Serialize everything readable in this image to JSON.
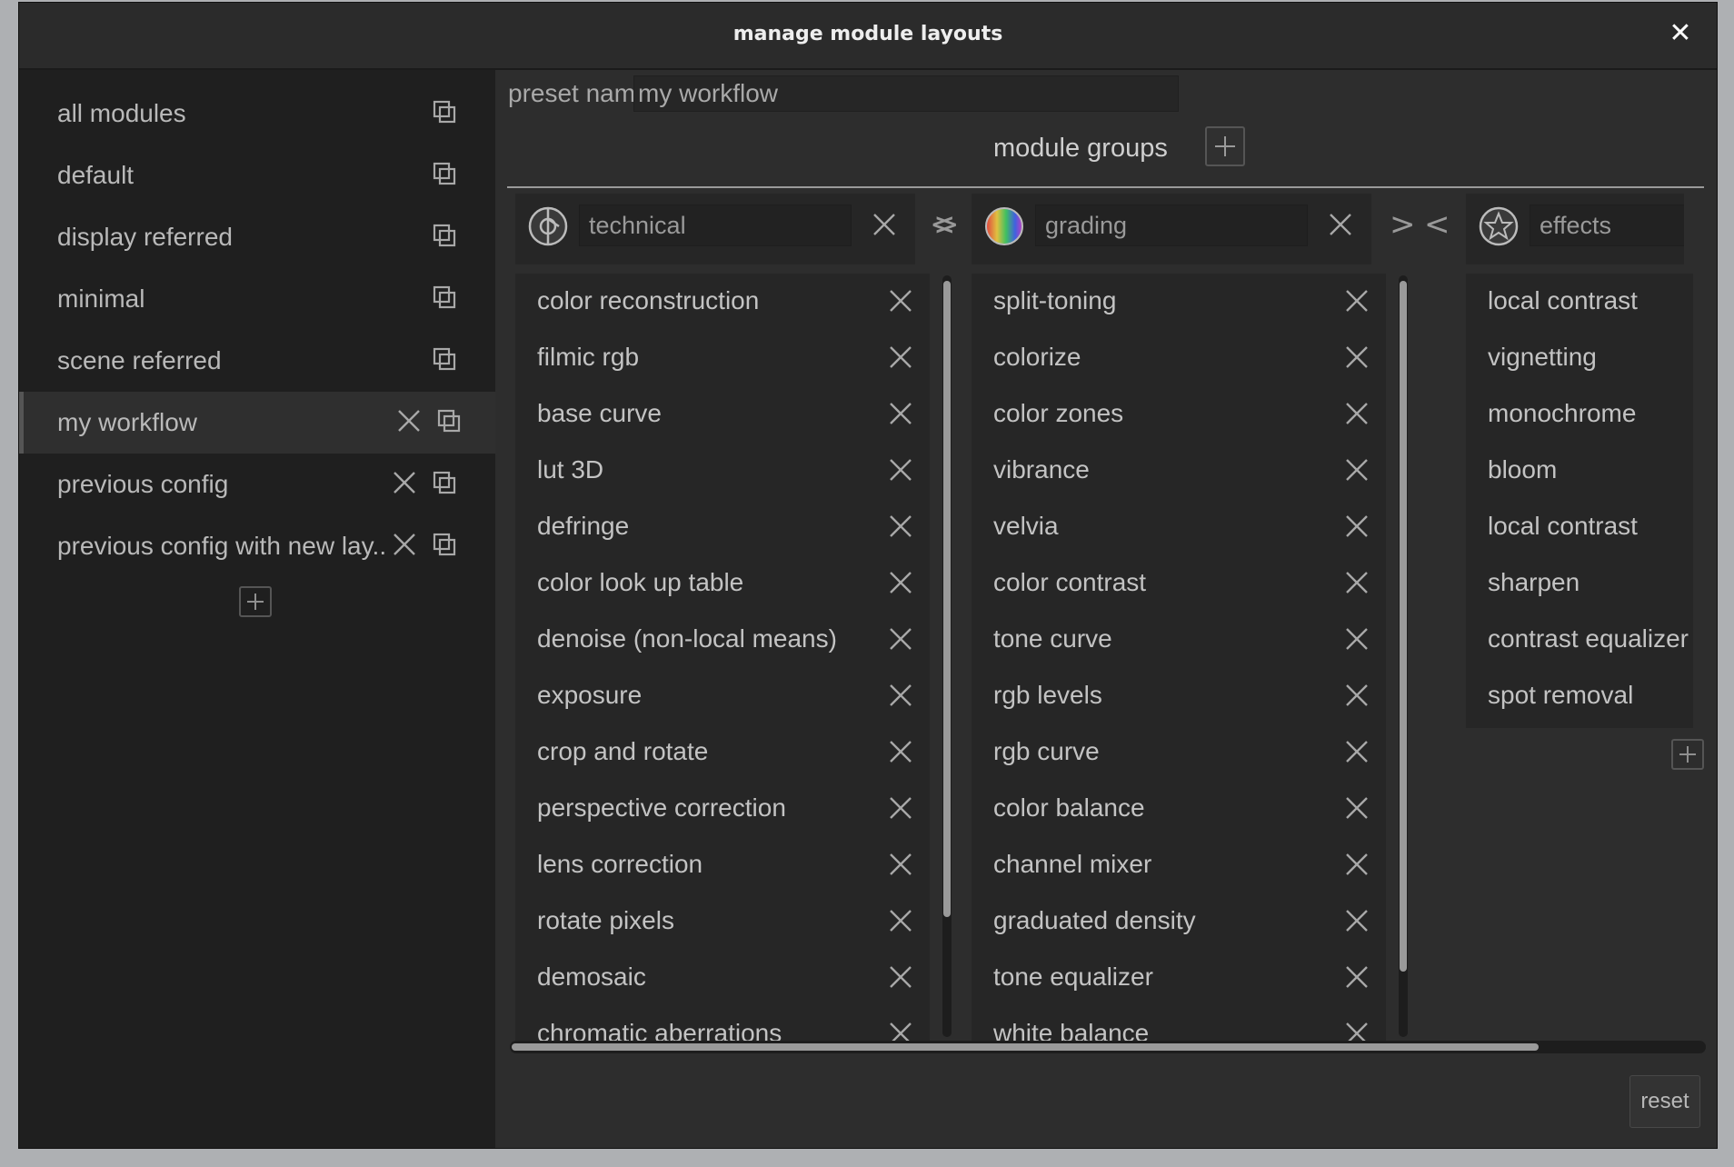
{
  "window": {
    "title": "manage module layouts",
    "close_glyph": "✕"
  },
  "sidebar": {
    "presets": [
      {
        "label": "all modules",
        "deletable": false,
        "active": false
      },
      {
        "label": "default",
        "deletable": false,
        "active": false
      },
      {
        "label": "display referred",
        "deletable": false,
        "active": false
      },
      {
        "label": "minimal",
        "deletable": false,
        "active": false
      },
      {
        "label": "scene referred",
        "deletable": false,
        "active": false
      },
      {
        "label": "my workflow",
        "deletable": true,
        "active": true
      },
      {
        "label": "previous config",
        "deletable": true,
        "active": false
      },
      {
        "label": "previous config with new lay...",
        "deletable": true,
        "active": false
      }
    ]
  },
  "editor": {
    "preset_name_label": "preset name :",
    "preset_name_value": "my workflow",
    "groups_heading": "module groups",
    "groups": [
      {
        "name": "technical",
        "icon": "technical-group-icon",
        "modules": [
          "color reconstruction",
          "filmic rgb",
          "base curve",
          "lut 3D",
          "defringe",
          "color look up table",
          "denoise (non-local means)",
          "exposure",
          "crop and rotate",
          "perspective correction",
          "lens correction",
          "rotate pixels",
          "demosaic",
          "chromatic aberrations"
        ]
      },
      {
        "name": "grading",
        "icon": "grading-group-icon",
        "modules": [
          "split-toning",
          "colorize",
          "color zones",
          "vibrance",
          "velvia",
          "color contrast",
          "tone curve",
          "rgb levels",
          "rgb curve",
          "color balance",
          "channel mixer",
          "graduated density",
          "tone equalizer",
          "white balance"
        ]
      },
      {
        "name": "effects",
        "icon": "effects-group-icon",
        "modules": [
          "local contrast",
          "vignetting",
          "monochrome",
          "bloom",
          "local contrast",
          "sharpen",
          "contrast equalizer",
          "spot removal"
        ]
      }
    ],
    "reset_label": "reset",
    "arrow_right": ">",
    "arrow_left": "<",
    "colors": {
      "background": "#2d2d2d",
      "panel": "#262626",
      "sidebar": "#1f1f1f"
    }
  }
}
